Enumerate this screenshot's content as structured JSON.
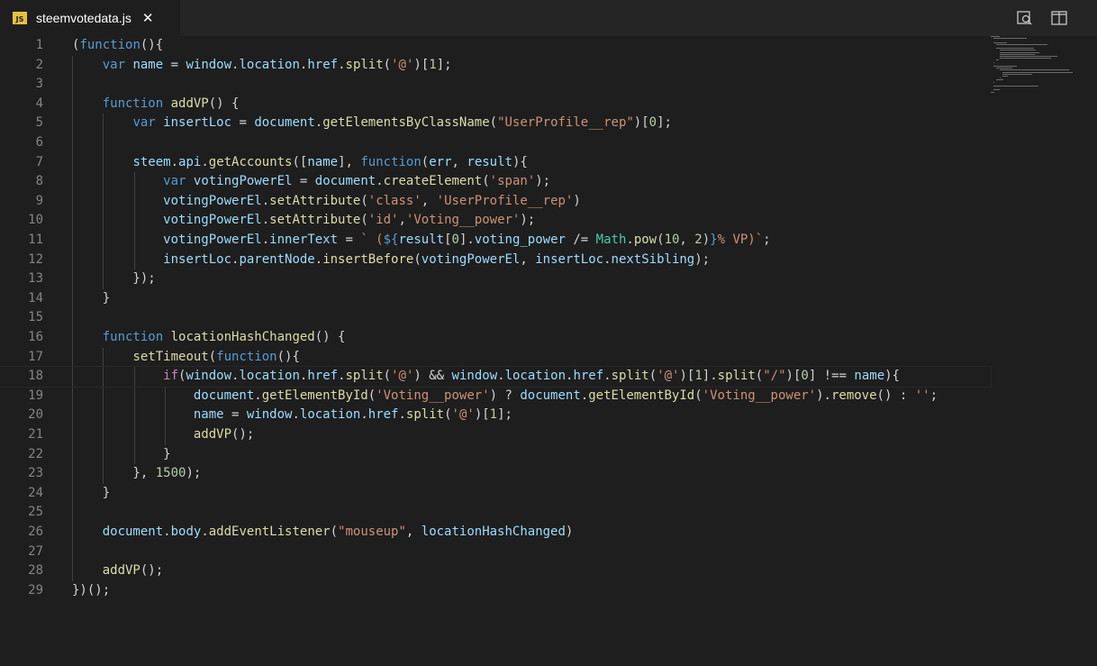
{
  "tab": {
    "icon": "js-file-icon",
    "icon_text": "JS",
    "title": "steemvotedata.js",
    "close_icon": "close-icon"
  },
  "toolbar": {
    "icons": [
      "open-preview-icon",
      "split-editor-icon"
    ]
  },
  "theme": {
    "background": "#1e1e1e",
    "keyword": "#569cd6",
    "function": "#dcdcaa",
    "variable": "#9cdcfe",
    "string": "#ce9178",
    "number": "#b5cea8",
    "class": "#4ec9b0",
    "control": "#c586c0"
  },
  "cursor_line": 18,
  "lines": [
    [
      [
        "pu",
        "("
      ],
      [
        "kw",
        "function"
      ],
      [
        "pu",
        "(){"
      ]
    ],
    [
      [
        "pu",
        "    "
      ],
      [
        "kw",
        "var"
      ],
      [
        "pu",
        " "
      ],
      [
        "vr",
        "name"
      ],
      [
        "pu",
        " = "
      ],
      [
        "vr",
        "window"
      ],
      [
        "pu",
        "."
      ],
      [
        "vr",
        "location"
      ],
      [
        "pu",
        "."
      ],
      [
        "vr",
        "href"
      ],
      [
        "pu",
        "."
      ],
      [
        "fn",
        "split"
      ],
      [
        "pu",
        "("
      ],
      [
        "st",
        "'@'"
      ],
      [
        "pu",
        ")["
      ],
      [
        "nm",
        "1"
      ],
      [
        "pu",
        "];"
      ]
    ],
    [],
    [
      [
        "pu",
        "    "
      ],
      [
        "kw",
        "function"
      ],
      [
        "pu",
        " "
      ],
      [
        "fn",
        "addVP"
      ],
      [
        "pu",
        "() {"
      ]
    ],
    [
      [
        "pu",
        "        "
      ],
      [
        "kw",
        "var"
      ],
      [
        "pu",
        " "
      ],
      [
        "vr",
        "insertLoc"
      ],
      [
        "pu",
        " = "
      ],
      [
        "vr",
        "document"
      ],
      [
        "pu",
        "."
      ],
      [
        "fn",
        "getElementsByClassName"
      ],
      [
        "pu",
        "("
      ],
      [
        "st",
        "\"UserProfile__rep\""
      ],
      [
        "pu",
        ")["
      ],
      [
        "nm",
        "0"
      ],
      [
        "pu",
        "];"
      ]
    ],
    [],
    [
      [
        "pu",
        "        "
      ],
      [
        "vr",
        "steem"
      ],
      [
        "pu",
        "."
      ],
      [
        "vr",
        "api"
      ],
      [
        "pu",
        "."
      ],
      [
        "fn",
        "getAccounts"
      ],
      [
        "pu",
        "(["
      ],
      [
        "vr",
        "name"
      ],
      [
        "pu",
        "], "
      ],
      [
        "kw",
        "function"
      ],
      [
        "pu",
        "("
      ],
      [
        "vr",
        "err"
      ],
      [
        "pu",
        ", "
      ],
      [
        "vr",
        "result"
      ],
      [
        "pu",
        "){"
      ]
    ],
    [
      [
        "pu",
        "            "
      ],
      [
        "kw",
        "var"
      ],
      [
        "pu",
        " "
      ],
      [
        "vr",
        "votingPowerEl"
      ],
      [
        "pu",
        " = "
      ],
      [
        "vr",
        "document"
      ],
      [
        "pu",
        "."
      ],
      [
        "fn",
        "createElement"
      ],
      [
        "pu",
        "("
      ],
      [
        "st",
        "'span'"
      ],
      [
        "pu",
        ");"
      ]
    ],
    [
      [
        "pu",
        "            "
      ],
      [
        "vr",
        "votingPowerEl"
      ],
      [
        "pu",
        "."
      ],
      [
        "fn",
        "setAttribute"
      ],
      [
        "pu",
        "("
      ],
      [
        "st",
        "'class'"
      ],
      [
        "pu",
        ", "
      ],
      [
        "st",
        "'UserProfile__rep'"
      ],
      [
        "pu",
        ")"
      ]
    ],
    [
      [
        "pu",
        "            "
      ],
      [
        "vr",
        "votingPowerEl"
      ],
      [
        "pu",
        "."
      ],
      [
        "fn",
        "setAttribute"
      ],
      [
        "pu",
        "("
      ],
      [
        "st",
        "'id'"
      ],
      [
        "pu",
        ","
      ],
      [
        "st",
        "'Voting__power'"
      ],
      [
        "pu",
        ");"
      ]
    ],
    [
      [
        "pu",
        "            "
      ],
      [
        "vr",
        "votingPowerEl"
      ],
      [
        "pu",
        "."
      ],
      [
        "vr",
        "innerText"
      ],
      [
        "pu",
        " = "
      ],
      [
        "st",
        "` ("
      ],
      [
        "kw",
        "${"
      ],
      [
        "vr",
        "result"
      ],
      [
        "pu",
        "["
      ],
      [
        "nm",
        "0"
      ],
      [
        "pu",
        "]."
      ],
      [
        "vr",
        "voting_power"
      ],
      [
        "pu",
        " /= "
      ],
      [
        "cl",
        "Math"
      ],
      [
        "pu",
        "."
      ],
      [
        "fn",
        "pow"
      ],
      [
        "pu",
        "("
      ],
      [
        "nm",
        "10"
      ],
      [
        "pu",
        ", "
      ],
      [
        "nm",
        "2"
      ],
      [
        "pu",
        ")"
      ],
      [
        "kw",
        "}"
      ],
      [
        "st",
        "% VP)`"
      ],
      [
        "pu",
        ";"
      ]
    ],
    [
      [
        "pu",
        "            "
      ],
      [
        "vr",
        "insertLoc"
      ],
      [
        "pu",
        "."
      ],
      [
        "vr",
        "parentNode"
      ],
      [
        "pu",
        "."
      ],
      [
        "fn",
        "insertBefore"
      ],
      [
        "pu",
        "("
      ],
      [
        "vr",
        "votingPowerEl"
      ],
      [
        "pu",
        ", "
      ],
      [
        "vr",
        "insertLoc"
      ],
      [
        "pu",
        "."
      ],
      [
        "vr",
        "nextSibling"
      ],
      [
        "pu",
        ");"
      ]
    ],
    [
      [
        "pu",
        "        });"
      ]
    ],
    [
      [
        "pu",
        "    }"
      ]
    ],
    [],
    [
      [
        "pu",
        "    "
      ],
      [
        "kw",
        "function"
      ],
      [
        "pu",
        " "
      ],
      [
        "fn",
        "locationHashChanged"
      ],
      [
        "pu",
        "() {"
      ]
    ],
    [
      [
        "pu",
        "        "
      ],
      [
        "fn",
        "setTimeout"
      ],
      [
        "pu",
        "("
      ],
      [
        "kw",
        "function"
      ],
      [
        "pu",
        "(){"
      ]
    ],
    [
      [
        "pu",
        "            "
      ],
      [
        "ctl",
        "if"
      ],
      [
        "pu",
        "("
      ],
      [
        "vr",
        "window"
      ],
      [
        "pu",
        "."
      ],
      [
        "vr",
        "location"
      ],
      [
        "pu",
        "."
      ],
      [
        "vr",
        "href"
      ],
      [
        "pu",
        "."
      ],
      [
        "fn",
        "split"
      ],
      [
        "pu",
        "("
      ],
      [
        "st",
        "'@'"
      ],
      [
        "pu",
        ") && "
      ],
      [
        "vr",
        "window"
      ],
      [
        "pu",
        "."
      ],
      [
        "vr",
        "location"
      ],
      [
        "pu",
        "."
      ],
      [
        "vr",
        "href"
      ],
      [
        "pu",
        "."
      ],
      [
        "fn",
        "split"
      ],
      [
        "pu",
        "("
      ],
      [
        "st",
        "'@'"
      ],
      [
        "pu",
        ")["
      ],
      [
        "nm",
        "1"
      ],
      [
        "pu",
        "]."
      ],
      [
        "fn",
        "split"
      ],
      [
        "pu",
        "("
      ],
      [
        "st",
        "\"/\""
      ],
      [
        "pu",
        ")["
      ],
      [
        "nm",
        "0"
      ],
      [
        "pu",
        "] !== "
      ],
      [
        "vr",
        "name"
      ],
      [
        "pu",
        "){"
      ]
    ],
    [
      [
        "pu",
        "                "
      ],
      [
        "vr",
        "document"
      ],
      [
        "pu",
        "."
      ],
      [
        "fn",
        "getElementById"
      ],
      [
        "pu",
        "("
      ],
      [
        "st",
        "'Voting__power'"
      ],
      [
        "pu",
        ") ? "
      ],
      [
        "vr",
        "document"
      ],
      [
        "pu",
        "."
      ],
      [
        "fn",
        "getElementById"
      ],
      [
        "pu",
        "("
      ],
      [
        "st",
        "'Voting__power'"
      ],
      [
        "pu",
        ")."
      ],
      [
        "fn",
        "remove"
      ],
      [
        "pu",
        "() : "
      ],
      [
        "st",
        "''"
      ],
      [
        "pu",
        ";"
      ]
    ],
    [
      [
        "pu",
        "                "
      ],
      [
        "vr",
        "name"
      ],
      [
        "pu",
        " = "
      ],
      [
        "vr",
        "window"
      ],
      [
        "pu",
        "."
      ],
      [
        "vr",
        "location"
      ],
      [
        "pu",
        "."
      ],
      [
        "vr",
        "href"
      ],
      [
        "pu",
        "."
      ],
      [
        "fn",
        "split"
      ],
      [
        "pu",
        "("
      ],
      [
        "st",
        "'@'"
      ],
      [
        "pu",
        ")["
      ],
      [
        "nm",
        "1"
      ],
      [
        "pu",
        "];"
      ]
    ],
    [
      [
        "pu",
        "                "
      ],
      [
        "fn",
        "addVP"
      ],
      [
        "pu",
        "();"
      ]
    ],
    [
      [
        "pu",
        "            }"
      ]
    ],
    [
      [
        "pu",
        "        }, "
      ],
      [
        "nm",
        "1500"
      ],
      [
        "pu",
        ");"
      ]
    ],
    [
      [
        "pu",
        "    }"
      ]
    ],
    [],
    [
      [
        "pu",
        "    "
      ],
      [
        "vr",
        "document"
      ],
      [
        "pu",
        "."
      ],
      [
        "vr",
        "body"
      ],
      [
        "pu",
        "."
      ],
      [
        "fn",
        "addEventListener"
      ],
      [
        "pu",
        "("
      ],
      [
        "st",
        "\"mouseup\""
      ],
      [
        "pu",
        ", "
      ],
      [
        "vr",
        "locationHashChanged"
      ],
      [
        "pu",
        ")"
      ]
    ],
    [],
    [
      [
        "pu",
        "    "
      ],
      [
        "fn",
        "addVP"
      ],
      [
        "pu",
        "();"
      ]
    ],
    [
      [
        "pu",
        "})();"
      ]
    ]
  ]
}
